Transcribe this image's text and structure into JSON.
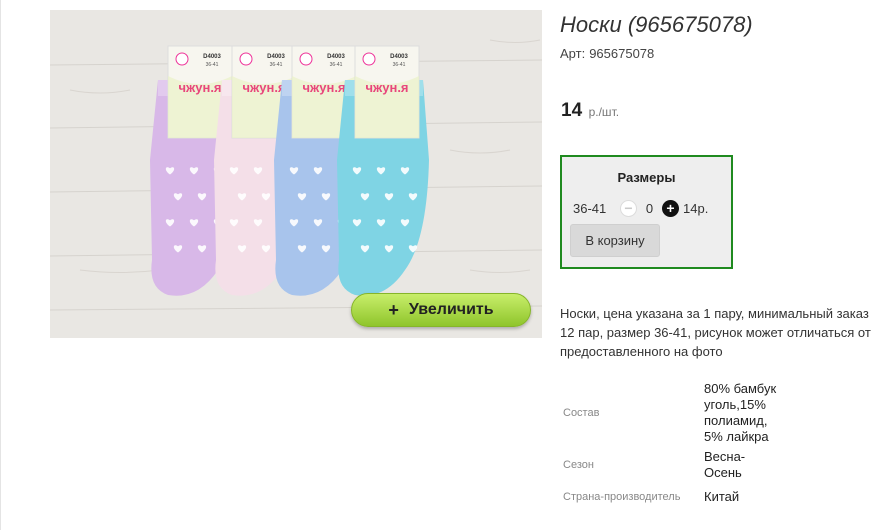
{
  "product": {
    "title": "Носки (965675078)",
    "article_label": "Арт:",
    "article_value": "965675078",
    "price_amount": "14",
    "price_unit": "р./шт."
  },
  "photo": {
    "zoom_label": "Увеличить",
    "zoom_icon": "plus-icon",
    "sock_label_text": "чжун.я",
    "tag_code": "D4003",
    "tag_size": "36-41",
    "sock_colors": [
      "#d8b8e8",
      "#f4dfe8",
      "#a8c4ec",
      "#7fd4e4"
    ]
  },
  "sizes": {
    "title": "Размеры",
    "items": [
      {
        "size": "36-41",
        "quantity": "0",
        "price": "14р."
      }
    ],
    "minus_icon": "minus-circle-icon",
    "plus_icon": "plus-circle-icon",
    "add_to_cart_label": "В корзину"
  },
  "description": "Носки, цена указана за 1 пару, минимальный заказ 12 пар, размер 36-41, рисунок может отличаться от предоставленного на фото",
  "properties": [
    {
      "label": "Состав",
      "value": "80% бамбук\nуголь,15%\nполиамид,\n5% лайкра"
    },
    {
      "label": "Сезон",
      "value": "Весна-\nОсень"
    },
    {
      "label": "Страна-производитель",
      "value": "Китай"
    }
  ],
  "colors": {
    "sizes_border": "#1f8a1f",
    "zoom_button": "#a6d83c"
  }
}
